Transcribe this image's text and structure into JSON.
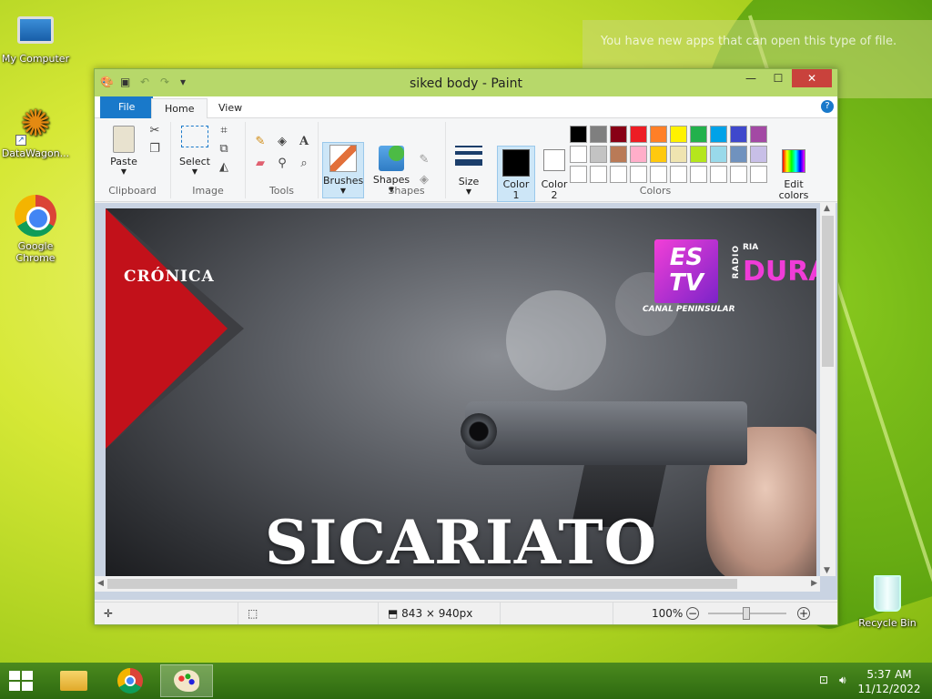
{
  "desktop": {
    "icons": [
      {
        "label": "My Computer"
      },
      {
        "label": "DataWagon..."
      },
      {
        "label": "Google Chrome"
      },
      {
        "label": "Recycle Bin"
      }
    ],
    "notification": "You have new apps that can open this type of file."
  },
  "window": {
    "title": "siked body - Paint",
    "tabs": {
      "file": "File",
      "home": "Home",
      "view": "View"
    },
    "help": "?",
    "ribbon": {
      "clipboard": {
        "label": "Clipboard",
        "paste": "Paste"
      },
      "image": {
        "label": "Image",
        "select": "Select"
      },
      "tools": {
        "label": "Tools",
        "text_tool": "A"
      },
      "brushes": "Brushes",
      "shapes": {
        "label": "Shapes",
        "shapes_btn": "Shapes"
      },
      "size": "Size",
      "colors": {
        "label": "Colors",
        "color1": "Color 1",
        "color2": "Color 2",
        "edit_colors": "Edit colors",
        "palette": [
          "#000000",
          "#7f7f7f",
          "#880015",
          "#ed1c24",
          "#ff7f27",
          "#fff200",
          "#22b14c",
          "#00a2e8",
          "#3f48cc",
          "#a349a4",
          "#ffffff",
          "#c3c3c3",
          "#b97a57",
          "#ffaec9",
          "#ffc90e",
          "#efe4b0",
          "#b5e61d",
          "#99d9ea",
          "#7092be",
          "#c8bfe7",
          "#ffffff",
          "#ffffff",
          "#ffffff",
          "#ffffff",
          "#ffffff",
          "#ffffff",
          "#ffffff",
          "#ffffff",
          "#ffffff",
          "#ffffff"
        ]
      }
    },
    "image": {
      "banner": "CRÓNICA",
      "headline": "SICARIATO",
      "logo1": "ES TV",
      "logo1_caption": "CANAL PENINSULAR",
      "logo2_radio": "RADIO",
      "logo2_ria": "RIA",
      "logo2_dura": "DURA"
    },
    "status": {
      "dimensions": "843 × 940px",
      "zoom": "100%"
    }
  },
  "taskbar": {
    "time": "5:37 AM",
    "date": "11/12/2022"
  }
}
